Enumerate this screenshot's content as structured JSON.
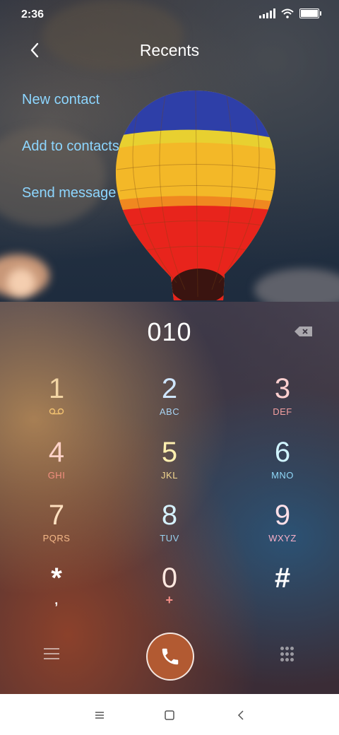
{
  "status_bar": {
    "time": "2:36"
  },
  "header": {
    "title": "Recents"
  },
  "menu": [
    {
      "label": "New contact"
    },
    {
      "label": "Add to contacts"
    },
    {
      "label": "Send message"
    }
  ],
  "dialer": {
    "number": "010",
    "keys": [
      {
        "digit": "1",
        "letters": "",
        "icon": "voicemail-icon",
        "digit_color": "#f2d4a4",
        "letter_color": "#f0c070"
      },
      {
        "digit": "2",
        "letters": "ABC",
        "digit_color": "#cfe6ff",
        "letter_color": "#a8d4f4"
      },
      {
        "digit": "3",
        "letters": "DEF",
        "digit_color": "#ffd0d0",
        "letter_color": "#f4a0a0"
      },
      {
        "digit": "4",
        "letters": "GHI",
        "digit_color": "#ffd2c8",
        "letter_color": "#f49080"
      },
      {
        "digit": "5",
        "letters": "JKL",
        "digit_color": "#fff0b0",
        "letter_color": "#f4d890"
      },
      {
        "digit": "6",
        "letters": "MNO",
        "digit_color": "#d0f4ff",
        "letter_color": "#90d8f8"
      },
      {
        "digit": "7",
        "letters": "PQRS",
        "digit_color": "#ffe0c0",
        "letter_color": "#f4b888"
      },
      {
        "digit": "8",
        "letters": "TUV",
        "digit_color": "#d6f2ff",
        "letter_color": "#98d2f0"
      },
      {
        "digit": "9",
        "letters": "WXYZ",
        "digit_color": "#ffe0e8",
        "letter_color": "#f8b0c8"
      },
      {
        "digit": "*",
        "letters": ",",
        "digit_color": "#ffffff",
        "letter_color": "#ffffff"
      },
      {
        "digit": "0",
        "letters": "+",
        "digit_color": "#ffe8e0",
        "letter_color": "#f89088"
      },
      {
        "digit": "#",
        "letters": "",
        "digit_color": "#ffffff",
        "letter_color": "#ffffff"
      }
    ],
    "call_button_color": "#b25a32"
  },
  "icons": {
    "back": "chevron-left-icon",
    "backspace": "backspace-icon",
    "menu": "hamburger-icon",
    "call": "phone-icon",
    "keypad": "keypad-icon"
  },
  "navbar": {
    "items": [
      "recents-nav",
      "home-nav",
      "back-nav"
    ]
  }
}
